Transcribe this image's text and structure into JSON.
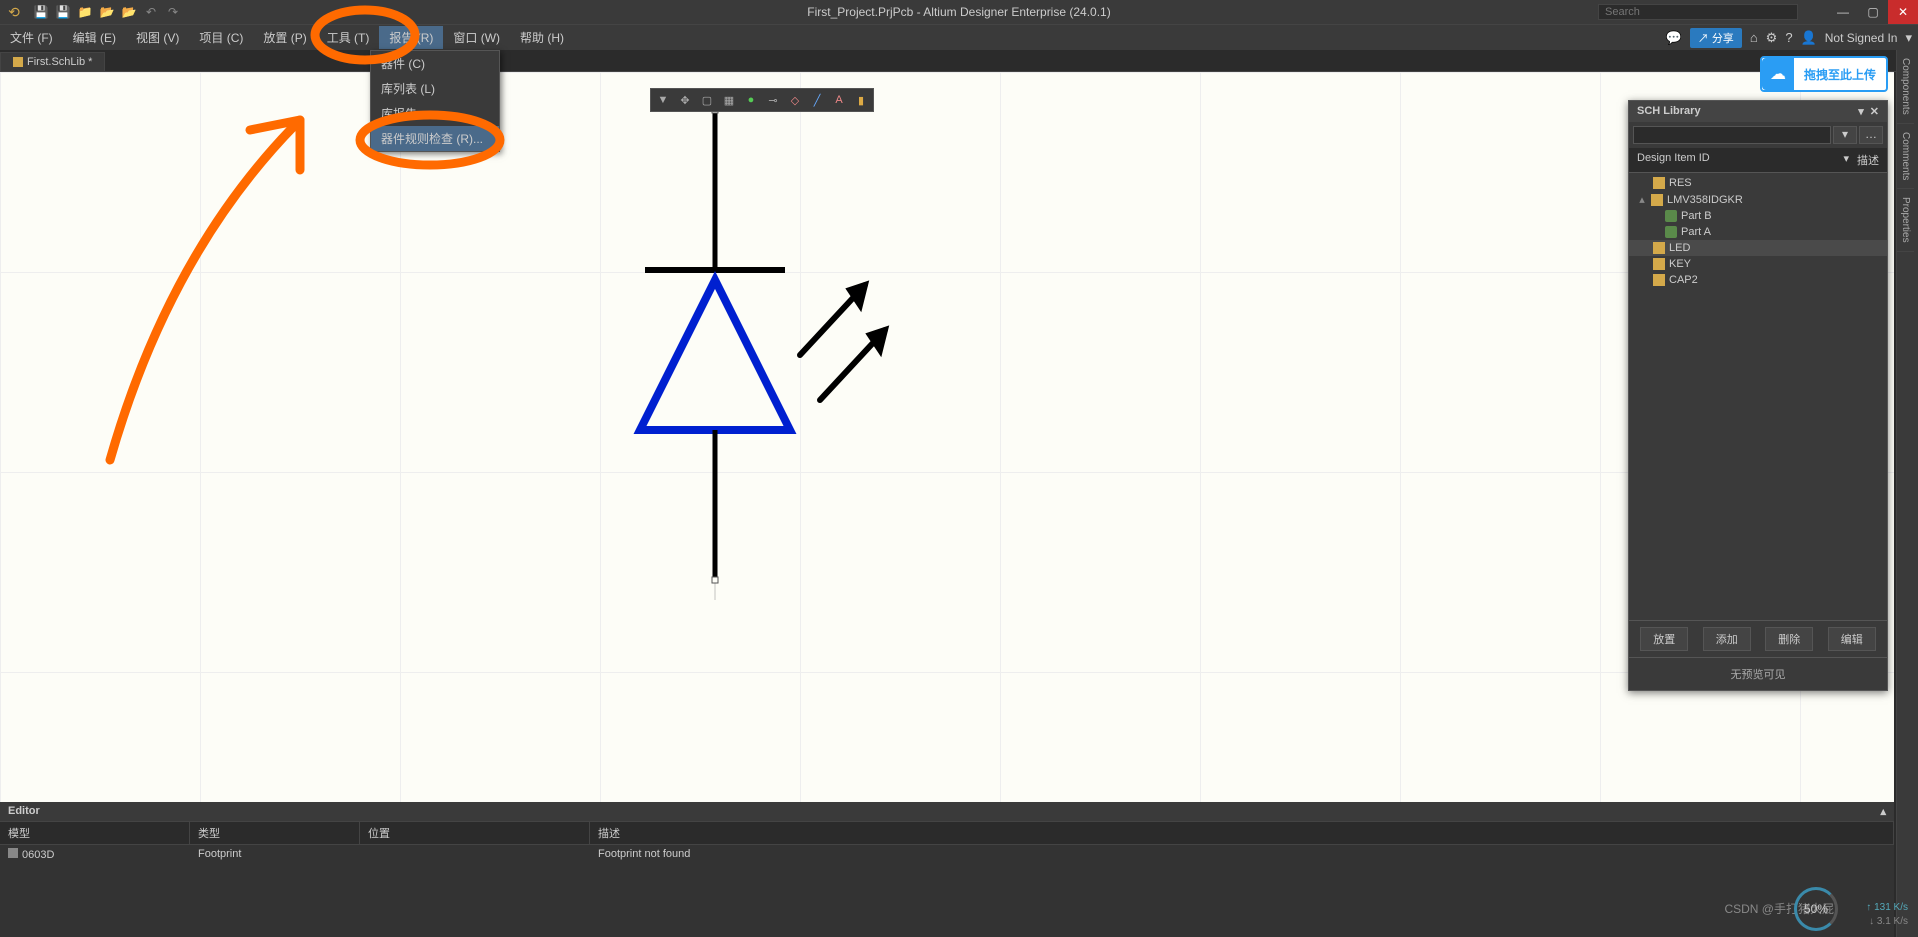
{
  "titlebar": {
    "title": "First_Project.PrjPcb - Altium Designer Enterprise (24.0.1)",
    "search_placeholder": "Search"
  },
  "menu": {
    "items": [
      "文件 (F)",
      "编辑 (E)",
      "视图 (V)",
      "项目 (C)",
      "放置 (P)",
      "工具 (T)",
      "报告 (R)",
      "窗口 (W)",
      "帮助 (H)"
    ],
    "active_index": 6,
    "share": "分享",
    "signin": "Not Signed In"
  },
  "dropdown": {
    "items": [
      "器件 (C)",
      "库列表 (L)",
      "库报告...",
      "器件规则检查 (R)..."
    ],
    "highlight_index": 3
  },
  "tab": {
    "label": "First.SchLib *"
  },
  "upload": {
    "text": "拖拽至此上传"
  },
  "sch": {
    "title": "SCH Library",
    "col1": "Design Item ID",
    "col2": "描述",
    "tree": [
      {
        "t": "item",
        "indent": 1,
        "icon": "f",
        "label": "RES"
      },
      {
        "t": "item",
        "indent": 0,
        "fold": "▴",
        "icon": "f",
        "label": "LMV358IDGKR"
      },
      {
        "t": "item",
        "indent": 2,
        "icon": "p",
        "label": "Part B"
      },
      {
        "t": "item",
        "indent": 2,
        "icon": "p",
        "label": "Part A"
      },
      {
        "t": "item",
        "indent": 1,
        "icon": "f",
        "label": "LED",
        "sel": true
      },
      {
        "t": "item",
        "indent": 1,
        "icon": "f",
        "label": "KEY"
      },
      {
        "t": "item",
        "indent": 1,
        "icon": "f",
        "label": "CAP2"
      }
    ],
    "btns": [
      "放置",
      "添加",
      "删除",
      "编辑"
    ],
    "footer": "无预览可见"
  },
  "rtabs": [
    "Components",
    "Comments",
    "Properties"
  ],
  "editor": {
    "title": "Editor",
    "cols": [
      "模型",
      "类型",
      "位置",
      "描述"
    ],
    "row": {
      "model": "0603D",
      "type": "Footprint",
      "pos": "",
      "desc": "Footprint not found"
    }
  },
  "watermark": "CSDN @手打猪大屁",
  "gauge": {
    "pct": "50%",
    "up": "↑ 131 K/s",
    "dn": "↓ 3.1 K/s"
  }
}
